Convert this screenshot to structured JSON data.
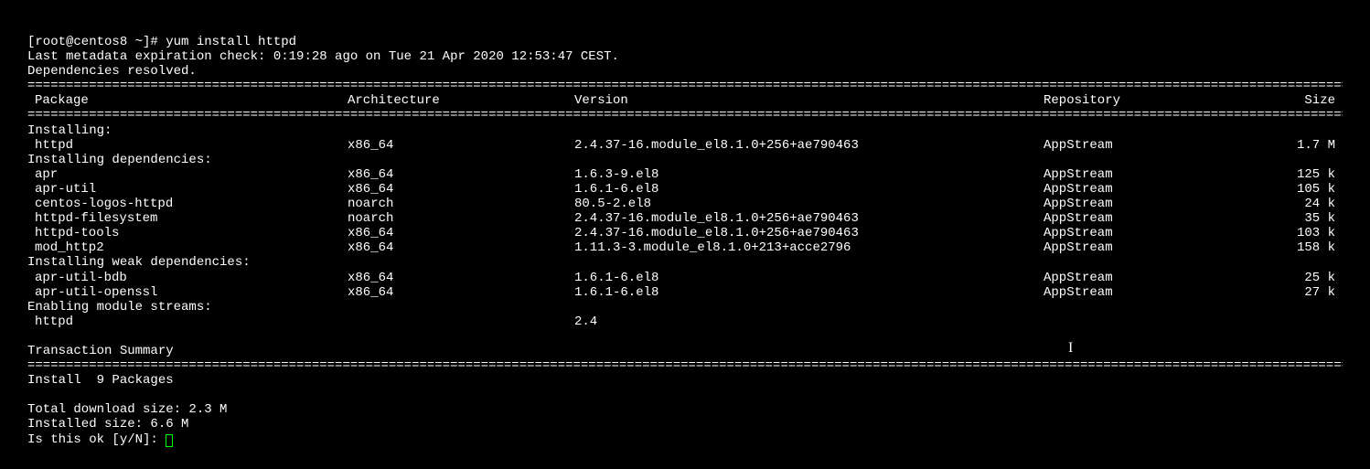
{
  "prompt": "[root@centos8 ~]# yum install httpd",
  "metadata_line": "Last metadata expiration check: 0:19:28 ago on Tue 21 Apr 2020 12:53:47 CEST.",
  "deps_resolved": "Dependencies resolved.",
  "rule": "==============================================================================================================================================================================================",
  "headers": {
    "package": "Package",
    "arch": "Architecture",
    "version": "Version",
    "repo": "Repository",
    "size": "Size"
  },
  "sections": {
    "installing": "Installing:",
    "installing_deps": "Installing dependencies:",
    "installing_weak": "Installing weak dependencies:",
    "enabling_streams": "Enabling module streams:"
  },
  "main_pkg": {
    "name": " httpd",
    "arch": "x86_64",
    "version": "2.4.37-16.module_el8.1.0+256+ae790463",
    "repo": "AppStream",
    "size": "1.7 M"
  },
  "deps": [
    {
      "name": " apr",
      "arch": "x86_64",
      "version": "1.6.3-9.el8",
      "repo": "AppStream",
      "size": "125 k"
    },
    {
      "name": " apr-util",
      "arch": "x86_64",
      "version": "1.6.1-6.el8",
      "repo": "AppStream",
      "size": "105 k"
    },
    {
      "name": " centos-logos-httpd",
      "arch": "noarch",
      "version": "80.5-2.el8",
      "repo": "AppStream",
      "size": "24 k"
    },
    {
      "name": " httpd-filesystem",
      "arch": "noarch",
      "version": "2.4.37-16.module_el8.1.0+256+ae790463",
      "repo": "AppStream",
      "size": "35 k"
    },
    {
      "name": " httpd-tools",
      "arch": "x86_64",
      "version": "2.4.37-16.module_el8.1.0+256+ae790463",
      "repo": "AppStream",
      "size": "103 k"
    },
    {
      "name": " mod_http2",
      "arch": "x86_64",
      "version": "1.11.3-3.module_el8.1.0+213+acce2796",
      "repo": "AppStream",
      "size": "158 k"
    }
  ],
  "weak_deps": [
    {
      "name": " apr-util-bdb",
      "arch": "x86_64",
      "version": "1.6.1-6.el8",
      "repo": "AppStream",
      "size": "25 k"
    },
    {
      "name": " apr-util-openssl",
      "arch": "x86_64",
      "version": "1.6.1-6.el8",
      "repo": "AppStream",
      "size": "27 k"
    }
  ],
  "streams": [
    {
      "name": " httpd",
      "arch": "",
      "version": "2.4",
      "repo": "",
      "size": ""
    }
  ],
  "transaction_summary": "Transaction Summary",
  "install_count": "Install  9 Packages",
  "total_download": "Total download size: 2.3 M",
  "installed_size": "Installed size: 6.6 M",
  "confirm_prompt": "Is this ok [y/N]: "
}
